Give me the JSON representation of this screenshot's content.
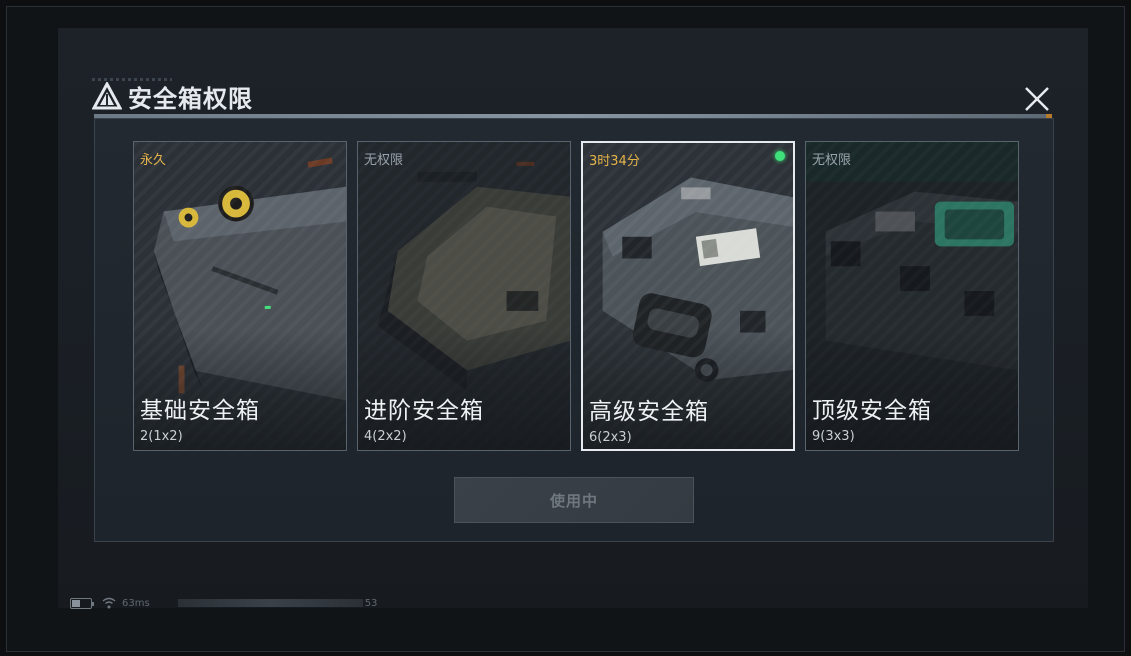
{
  "dialog": {
    "title": "安全箱权限",
    "title_icon": "triangle-logo-icon",
    "close_icon": "close-icon"
  },
  "cards": [
    {
      "status": "永久",
      "name": "基础安全箱",
      "size": "2(1x2)",
      "state": "owned",
      "selected": false
    },
    {
      "status": "无权限",
      "name": "进阶安全箱",
      "size": "4(2x2)",
      "state": "locked",
      "selected": false
    },
    {
      "status": "3时34分",
      "name": "高级安全箱",
      "size": "6(2x3)",
      "state": "active",
      "selected": true
    },
    {
      "status": "无权限",
      "name": "顶级安全箱",
      "size": "9(3x3)",
      "state": "locked",
      "selected": false
    }
  ],
  "use_button": {
    "label": "使用中",
    "enabled": false
  },
  "statusbar": {
    "ping": "63ms",
    "fps": "53"
  },
  "colors": {
    "gold_status": "#e5b34a",
    "active_dot": "#3ee07a",
    "selected_border": "#e6eaee",
    "dialog_bg": "#222930"
  }
}
